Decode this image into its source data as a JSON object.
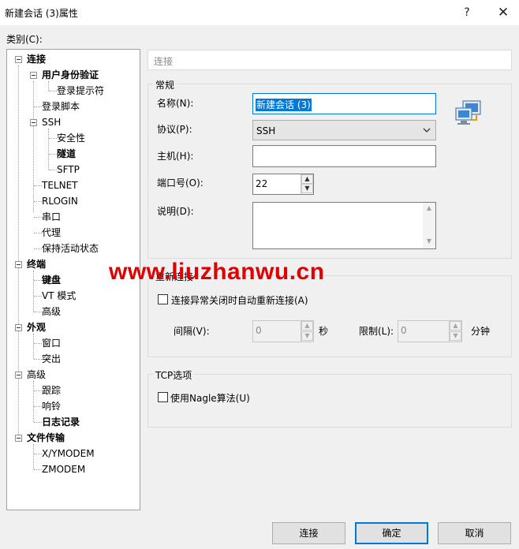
{
  "window": {
    "title": "新建会话 (3)属性",
    "help_label": "?",
    "close_label": "✕"
  },
  "category_label": "类别(C):",
  "tree": [
    {
      "label": "连接",
      "bold": true
    },
    {
      "label": "用户身份验证",
      "bold": true
    },
    {
      "label": "登录提示符",
      "bold": false
    },
    {
      "label": "登录脚本",
      "bold": false
    },
    {
      "label": "SSH",
      "bold": false
    },
    {
      "label": "安全性",
      "bold": false
    },
    {
      "label": "隧道",
      "bold": true
    },
    {
      "label": "SFTP",
      "bold": false
    },
    {
      "label": "TELNET",
      "bold": false
    },
    {
      "label": "RLOGIN",
      "bold": false
    },
    {
      "label": "串口",
      "bold": false
    },
    {
      "label": "代理",
      "bold": false
    },
    {
      "label": "保持活动状态",
      "bold": false
    },
    {
      "label": "终端",
      "bold": true
    },
    {
      "label": "键盘",
      "bold": true
    },
    {
      "label": "VT 模式",
      "bold": false
    },
    {
      "label": "高级",
      "bold": false
    },
    {
      "label": "外观",
      "bold": true
    },
    {
      "label": "窗口",
      "bold": false
    },
    {
      "label": "突出",
      "bold": false
    },
    {
      "label": "高级",
      "bold": false
    },
    {
      "label": "跟踪",
      "bold": false
    },
    {
      "label": "响铃",
      "bold": false
    },
    {
      "label": "日志记录",
      "bold": true
    },
    {
      "label": "文件传输",
      "bold": true
    },
    {
      "label": "X/YMODEM",
      "bold": false
    },
    {
      "label": "ZMODEM",
      "bold": false
    }
  ],
  "header": {
    "text": "连接"
  },
  "general": {
    "title": "常规",
    "name_label": "名称(N):",
    "name_value": "新建会话 (3)",
    "protocol_label": "协议(P):",
    "protocol_value": "SSH",
    "host_label": "主机(H):",
    "host_value": "",
    "port_label": "端口号(O):",
    "port_value": "22",
    "desc_label": "说明(D):",
    "desc_value": ""
  },
  "reconnect": {
    "title": "重新连接",
    "checkbox_label": "连接异常关闭时自动重新连接(A)",
    "checked": false,
    "interval_label": "间隔(V):",
    "interval_value": "0",
    "interval_unit": "秒",
    "limit_label": "限制(L):",
    "limit_value": "0",
    "limit_unit": "分钟"
  },
  "tcp": {
    "title": "TCP选项",
    "nagle_label": "使用Nagle算法(U)",
    "checked": false
  },
  "buttons": {
    "connect": "连接",
    "ok": "确定",
    "cancel": "取消"
  },
  "watermark": "www.liuzhanwu.cn",
  "colors": {
    "accent": "#0078d7",
    "watermark": "#e00000"
  }
}
